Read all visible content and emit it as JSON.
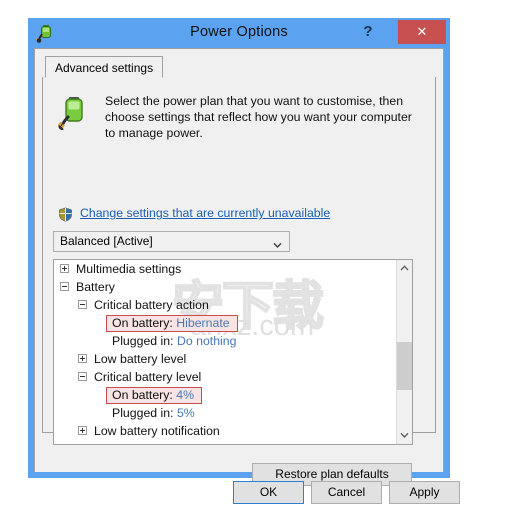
{
  "window": {
    "title": "Power Options",
    "icon": "power-plug-battery-icon",
    "accent_color": "#5ba3f0",
    "close_color": "#c75050",
    "help_label": "?",
    "close_label": "✕"
  },
  "tabs": [
    {
      "label": "Advanced settings",
      "selected": true
    }
  ],
  "header": {
    "icon": "battery-plug-icon",
    "text": "Select the power plan that you want to customise, then choose settings that reflect how you want your computer to manage power."
  },
  "uac": {
    "icon": "shield-icon",
    "link_text": "Change settings that are currently unavailable",
    "link_color": "#1a5fb4"
  },
  "plan_select": {
    "value": "Balanced [Active]",
    "options": [
      "Balanced [Active]"
    ],
    "arrow_icon": "chevron-down-icon"
  },
  "tree": {
    "watermark": {
      "cjk": "安下载",
      "domain": "anxz.com"
    },
    "rows": [
      {
        "indent": 0,
        "expander": "plus",
        "label": "Multimedia settings",
        "value": null,
        "highlight": false
      },
      {
        "indent": 0,
        "expander": "minus",
        "label": "Battery",
        "value": null,
        "highlight": false
      },
      {
        "indent": 1,
        "expander": "minus",
        "label": "Critical battery action",
        "value": null,
        "highlight": false
      },
      {
        "indent": 2,
        "expander": "none",
        "label": "On battery:",
        "value": "Hibernate",
        "highlight": true
      },
      {
        "indent": 2,
        "expander": "none",
        "label": "Plugged in:",
        "value": "Do nothing",
        "highlight": false
      },
      {
        "indent": 1,
        "expander": "plus",
        "label": "Low battery level",
        "value": null,
        "highlight": false
      },
      {
        "indent": 1,
        "expander": "minus",
        "label": "Critical battery level",
        "value": null,
        "highlight": false
      },
      {
        "indent": 2,
        "expander": "none",
        "label": "On battery:",
        "value": "4%",
        "highlight": true
      },
      {
        "indent": 2,
        "expander": "none",
        "label": "Plugged in:",
        "value": "5%",
        "highlight": false
      },
      {
        "indent": 1,
        "expander": "plus",
        "label": "Low battery notification",
        "value": null,
        "highlight": false
      }
    ],
    "highlight_border": "#c84a4a",
    "highlight_background": "#f8e4e4",
    "value_color": "#4a77b4",
    "scrollbar": {
      "up_icon": "chevron-up-icon",
      "down_icon": "chevron-down-icon",
      "thumb_position_pct": 45
    }
  },
  "buttons": {
    "restore": "Restore plan defaults",
    "ok": "OK",
    "cancel": "Cancel",
    "apply": "Apply"
  }
}
